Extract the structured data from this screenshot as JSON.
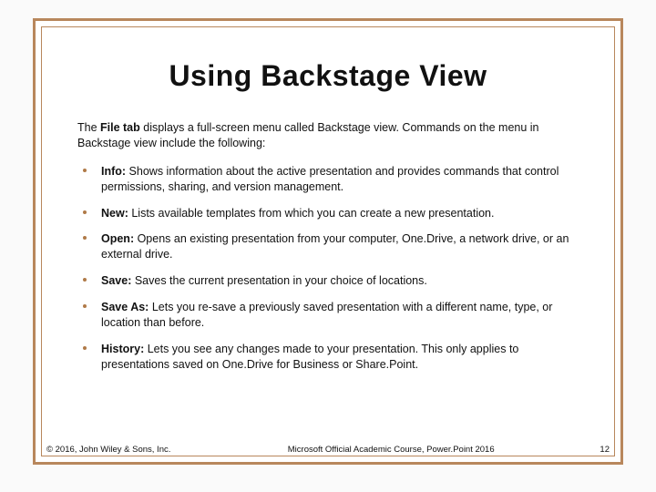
{
  "title": "Using Backstage View",
  "intro": {
    "prefix": "The ",
    "bold": "File tab",
    "suffix": " displays a full-screen menu called Backstage view. Commands on the menu in Backstage view include the following:"
  },
  "items": [
    {
      "label": "Info:",
      "text": " Shows information about the active presentation and provides commands that control permissions, sharing, and version management."
    },
    {
      "label": "New:",
      "text": " Lists available templates from which you can create a new presentation."
    },
    {
      "label": "Open:",
      "text": " Opens an existing presentation from your computer, One.Drive, a network drive, or an external drive."
    },
    {
      "label": "Save:",
      "text": " Saves the current presentation in your choice of locations."
    },
    {
      "label": "Save As:",
      "text": " Lets you re-save a previously saved presentation with a different name, type, or location than before."
    },
    {
      "label": "History:",
      "text": " Lets you see any changes made to your presentation. This only applies to presentations saved on One.Drive for Business or Share.Point."
    }
  ],
  "footer": {
    "left": "© 2016, John Wiley & Sons, Inc.",
    "center": "Microsoft Official Academic Course, Power.Point 2016",
    "right": "12"
  }
}
